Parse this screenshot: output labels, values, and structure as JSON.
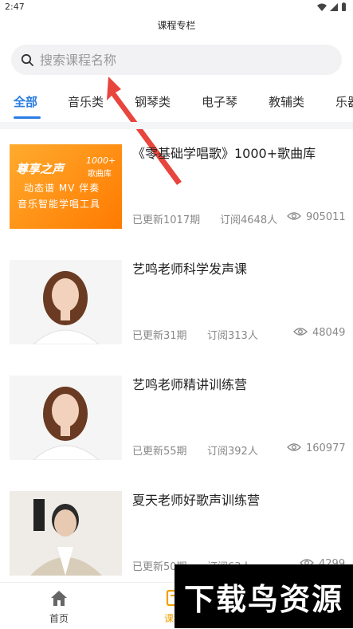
{
  "status": {
    "time": "2:47"
  },
  "header": {
    "title": "课程专栏"
  },
  "search": {
    "placeholder": "搜索课程名称"
  },
  "tabs": [
    {
      "label": "全部",
      "active": true
    },
    {
      "label": "音乐类"
    },
    {
      "label": "钢琴类"
    },
    {
      "label": "电子琴"
    },
    {
      "label": "教辅类"
    },
    {
      "label": "乐器"
    }
  ],
  "courses": [
    {
      "title": "《零基础学唱歌》1000+歌曲库",
      "updated": "已更新1017期",
      "subscribers": "订阅4648人",
      "views": "905011",
      "thumb": {
        "type": "banner",
        "brand": "尊享之声",
        "badge_top": "1000+",
        "badge_bottom": "歌曲库",
        "line1": "动态谱 MV 伴奏",
        "line2": "音乐智能学唱工具",
        "colors": {
          "from": "#ff9a1f",
          "to": "#ff7a00"
        }
      }
    },
    {
      "title": "艺鸣老师科学发声课",
      "updated": "已更新31期",
      "subscribers": "订阅313人",
      "views": "48049",
      "thumb": {
        "type": "portrait"
      }
    },
    {
      "title": "艺鸣老师精讲训练营",
      "updated": "已更新55期",
      "subscribers": "订阅392人",
      "views": "160977",
      "thumb": {
        "type": "portrait"
      }
    },
    {
      "title": "夏天老师好歌声训练营",
      "updated": "已更新50期",
      "subscribers": "订阅63人",
      "views": "4299",
      "thumb": {
        "type": "portrait-male"
      }
    }
  ],
  "nav": {
    "home_label": "首页",
    "course_label": "课程"
  },
  "watermark": {
    "text": "下载鸟资源"
  },
  "colors": {
    "accent": "#2a7de1",
    "nav_active": "#f0a000",
    "arrow": "#e8453c"
  }
}
